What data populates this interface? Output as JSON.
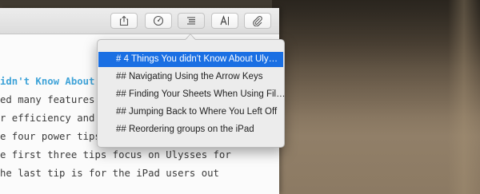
{
  "toolbar": {
    "buttons": [
      {
        "name": "share-icon"
      },
      {
        "name": "goals-icon"
      },
      {
        "name": "outline-list-icon"
      },
      {
        "name": "typography-icon"
      },
      {
        "name": "attachment-icon"
      }
    ]
  },
  "editor": {
    "lines": [
      "idn't Know About Ul",
      "ed many features i",
      "r efficiency and ke",
      "e four power tips,",
      "e first three tips focus on Ulysses for",
      "he last tip is for the iPad users out"
    ]
  },
  "menu": {
    "items": [
      {
        "label": "# 4 Things You didn't Know About Uly…",
        "selected": true
      },
      {
        "label": "## Navigating Using the Arrow Keys",
        "selected": false
      },
      {
        "label": "## Finding Your Sheets When Using Fil…",
        "selected": false
      },
      {
        "label": "## Jumping Back to Where You Left Off",
        "selected": false
      },
      {
        "label": "## Reordering groups on the iPad",
        "selected": false
      }
    ]
  },
  "colors": {
    "accent": "#1a6fe3",
    "heading": "#3fa3d8"
  }
}
